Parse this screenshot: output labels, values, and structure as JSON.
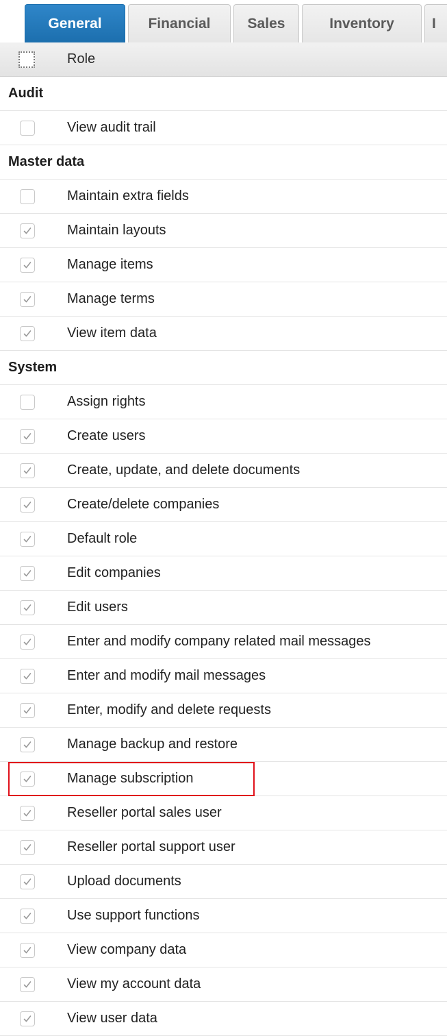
{
  "tabs": [
    {
      "label": "General",
      "active": true
    },
    {
      "label": "Financial",
      "active": false
    },
    {
      "label": "Sales",
      "active": false
    },
    {
      "label": "Inventory",
      "active": false
    },
    {
      "label": "I",
      "active": false
    }
  ],
  "header": {
    "role_label": "Role",
    "select_all_checked": false
  },
  "groups": [
    {
      "name": "Audit",
      "items": [
        {
          "label": "View audit trail",
          "checked": false
        }
      ]
    },
    {
      "name": "Master data",
      "items": [
        {
          "label": "Maintain extra fields",
          "checked": false
        },
        {
          "label": "Maintain layouts",
          "checked": true
        },
        {
          "label": "Manage items",
          "checked": true
        },
        {
          "label": "Manage terms",
          "checked": true
        },
        {
          "label": "View item data",
          "checked": true
        }
      ]
    },
    {
      "name": "System",
      "items": [
        {
          "label": "Assign rights",
          "checked": false
        },
        {
          "label": "Create users",
          "checked": true
        },
        {
          "label": "Create, update, and delete documents",
          "checked": true
        },
        {
          "label": "Create/delete companies",
          "checked": true
        },
        {
          "label": "Default role",
          "checked": true
        },
        {
          "label": "Edit companies",
          "checked": true
        },
        {
          "label": "Edit users",
          "checked": true
        },
        {
          "label": "Enter and modify company related mail messages",
          "checked": true
        },
        {
          "label": "Enter and modify mail messages",
          "checked": true
        },
        {
          "label": "Enter, modify and delete requests",
          "checked": true
        },
        {
          "label": "Manage backup and restore",
          "checked": true
        },
        {
          "label": "Manage subscription",
          "checked": true,
          "highlighted": true
        },
        {
          "label": "Reseller portal sales user",
          "checked": true
        },
        {
          "label": "Reseller portal support user",
          "checked": true
        },
        {
          "label": "Upload documents",
          "checked": true
        },
        {
          "label": "Use support functions",
          "checked": true
        },
        {
          "label": "View company data",
          "checked": true
        },
        {
          "label": "View my account data",
          "checked": true
        },
        {
          "label": "View user data",
          "checked": true
        }
      ]
    }
  ],
  "colors": {
    "active_tab": "#1c6fae",
    "highlight_border": "#e0101a",
    "check_mark": "#9a9a9a"
  }
}
